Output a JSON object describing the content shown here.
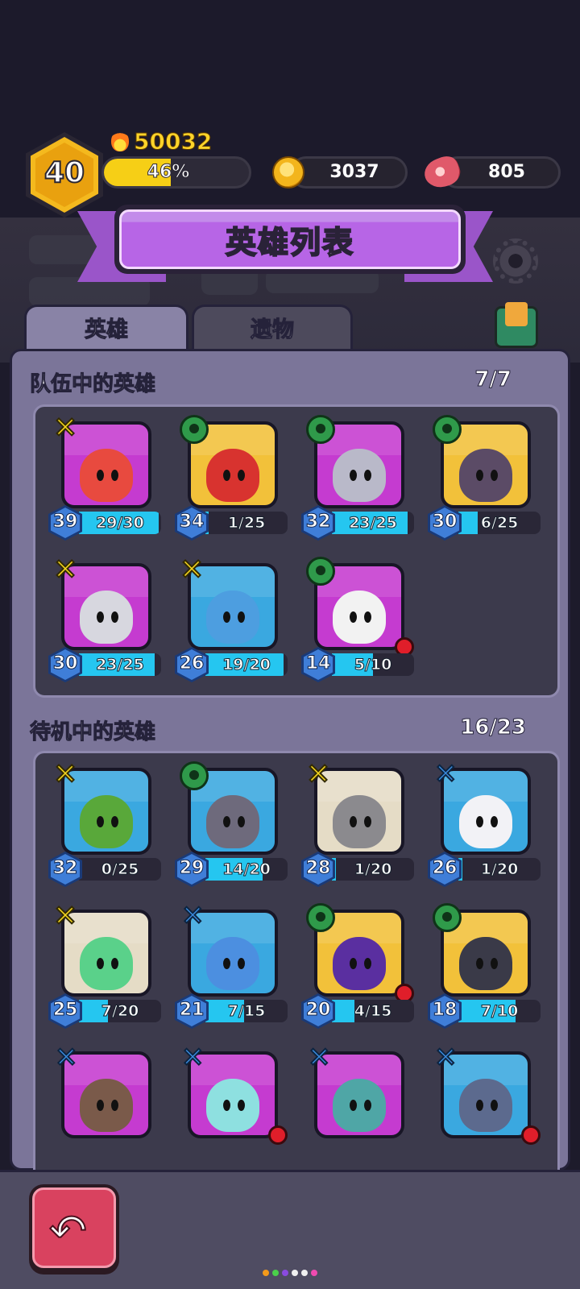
{
  "player": {
    "level": "40",
    "power": "50032",
    "xp_percent_label": "46%",
    "xp_fraction": 0.46
  },
  "resources": {
    "coins": "3037",
    "meat": "805"
  },
  "header": {
    "title": "英雄列表"
  },
  "tabs": [
    {
      "label": "英雄"
    },
    {
      "label": "遗物"
    }
  ],
  "team": {
    "title": "队伍中的英雄",
    "count": "7/7",
    "heroes": [
      {
        "level": "39",
        "shards": "29/30",
        "ratio": 0.97,
        "badge": "yellow",
        "bg": "#c53bd0",
        "color": "#e84a3f",
        "dot": false
      },
      {
        "level": "34",
        "shards": "1/25",
        "ratio": 0.04,
        "badge": "green",
        "bg": "#f2c13a",
        "color": "#d8332f",
        "dot": false
      },
      {
        "level": "32",
        "shards": "23/25",
        "ratio": 0.92,
        "badge": "green",
        "bg": "#c53bd0",
        "color": "#b9b9c9",
        "dot": false
      },
      {
        "level": "30",
        "shards": "6/25",
        "ratio": 0.24,
        "badge": "green",
        "bg": "#f2c13a",
        "color": "#5b4b66",
        "dot": false
      },
      {
        "level": "30",
        "shards": "23/25",
        "ratio": 0.92,
        "badge": "yellow",
        "bg": "#c53bd0",
        "color": "#d7d7df",
        "dot": false
      },
      {
        "level": "26",
        "shards": "19/20",
        "ratio": 0.95,
        "badge": "yellow",
        "bg": "#3aa8e0",
        "color": "#4d9ee0",
        "dot": false
      },
      {
        "level": "14",
        "shards": "5/10",
        "ratio": 0.5,
        "badge": "green",
        "bg": "#c53bd0",
        "color": "#f2f2f2",
        "dot": true
      }
    ]
  },
  "bench": {
    "title": "待机中的英雄",
    "count": "16/23",
    "heroes": [
      {
        "level": "32",
        "shards": "0/25",
        "ratio": 0.0,
        "badge": "yellow",
        "bg": "#3aa8e0",
        "color": "#59a83a",
        "dot": false
      },
      {
        "level": "29",
        "shards": "14/20",
        "ratio": 0.7,
        "badge": "green",
        "bg": "#3aa8e0",
        "color": "#6e6a7c",
        "dot": false
      },
      {
        "level": "28",
        "shards": "1/20",
        "ratio": 0.05,
        "badge": "yellow",
        "bg": "#e5dcc6",
        "color": "#8b8a8e",
        "dot": false
      },
      {
        "level": "26",
        "shards": "1/20",
        "ratio": 0.05,
        "badge": "blue",
        "bg": "#3aa8e0",
        "color": "#f2f2f6",
        "dot": false
      },
      {
        "level": "25",
        "shards": "7/20",
        "ratio": 0.35,
        "badge": "yellow",
        "bg": "#e5dcc6",
        "color": "#5ad18a",
        "dot": false
      },
      {
        "level": "21",
        "shards": "7/15",
        "ratio": 0.47,
        "badge": "blue",
        "bg": "#3aa8e0",
        "color": "#4c8fe0",
        "dot": false
      },
      {
        "level": "20",
        "shards": "4/15",
        "ratio": 0.27,
        "badge": "green",
        "bg": "#f2c13a",
        "color": "#5a2fa0",
        "dot": true
      },
      {
        "level": "18",
        "shards": "7/10",
        "ratio": 0.7,
        "badge": "green",
        "bg": "#f2c13a",
        "color": "#3a3a48",
        "dot": false
      },
      {
        "level": "",
        "shards": "",
        "ratio": 0,
        "badge": "blue",
        "bg": "#c53bd0",
        "color": "#7a5a4a",
        "dot": false
      },
      {
        "level": "",
        "shards": "",
        "ratio": 0,
        "badge": "blue",
        "bg": "#c53bd0",
        "color": "#8ee0e0",
        "dot": true
      },
      {
        "level": "",
        "shards": "",
        "ratio": 0,
        "badge": "blue",
        "bg": "#c53bd0",
        "color": "#4fa6a6",
        "dot": false
      },
      {
        "level": "",
        "shards": "",
        "ratio": 0,
        "badge": "blue",
        "bg": "#3aa8e0",
        "color": "#5c6a8e",
        "dot": true
      }
    ]
  },
  "page_dots": [
    "#f39a1a",
    "#4ad04a",
    "#8a4ae0",
    "#f0f0f0",
    "#f0f0f0",
    "#f04ab0"
  ]
}
